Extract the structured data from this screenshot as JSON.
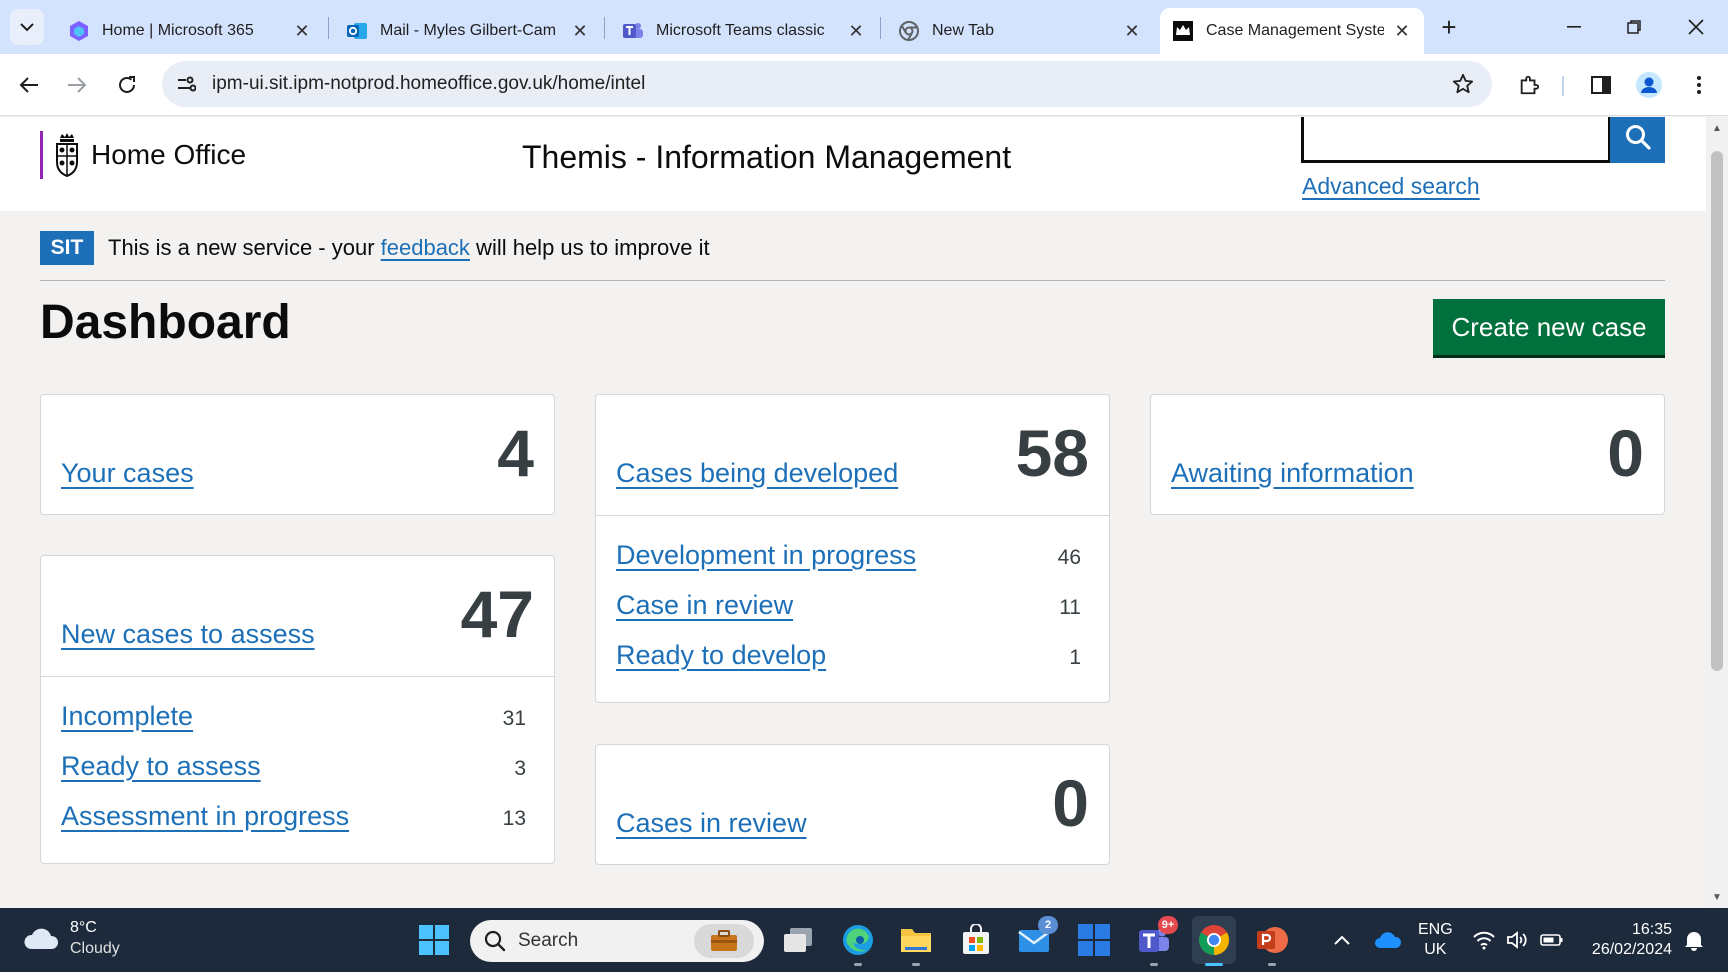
{
  "browser": {
    "tabs": [
      {
        "title": "Home | Microsoft 365",
        "icon": "m365-icon"
      },
      {
        "title": "Mail - Myles Gilbert-Cam",
        "icon": "outlook-icon"
      },
      {
        "title": "Microsoft Teams classic",
        "icon": "teams-icon"
      },
      {
        "title": "New Tab",
        "icon": "chrome-icon"
      },
      {
        "title": "Case Management Syster",
        "icon": "crown-icon",
        "active": true
      }
    ],
    "url": "ipm-ui.sit.ipm-notprod.homeoffice.gov.uk/home/intel"
  },
  "header": {
    "org_name": "Home Office",
    "service_name": "Themis - Information Management",
    "search_placeholder": "",
    "advanced_search": "Advanced search"
  },
  "phase_banner": {
    "tag": "SIT",
    "text_before": "This is a new service - your ",
    "link": "feedback",
    "text_after": " will help us to improve it"
  },
  "dashboard": {
    "title": "Dashboard",
    "create_button": "Create new case",
    "your_cases": {
      "label": "Your cases",
      "count": "4"
    },
    "new_cases": {
      "label": "New cases to assess",
      "count": "47",
      "items": [
        {
          "label": "Incomplete",
          "count": "31"
        },
        {
          "label": "Ready to assess",
          "count": "3"
        },
        {
          "label": "Assessment in progress",
          "count": "13"
        }
      ]
    },
    "being_developed": {
      "label": "Cases being developed",
      "count": "58",
      "items": [
        {
          "label": "Development in progress",
          "count": "46"
        },
        {
          "label": "Case in review",
          "count": "11"
        },
        {
          "label": "Ready to develop",
          "count": "1"
        }
      ]
    },
    "in_review": {
      "label": "Cases in review",
      "count": "0"
    },
    "awaiting": {
      "label": "Awaiting information",
      "count": "0"
    }
  },
  "taskbar": {
    "weather_temp": "8°C",
    "weather_cond": "Cloudy",
    "search_label": "Search",
    "mail_badge": "2",
    "teams_badge": "9+",
    "lang_1": "ENG",
    "lang_2": "UK",
    "time": "16:35",
    "date": "26/02/2024"
  },
  "colors": {
    "link": "#1d70b8",
    "button_green": "#00703c",
    "phase_tag": "#1d70b8",
    "tab_strip": "#d3e3fd",
    "taskbar": "#1c2a3b"
  }
}
